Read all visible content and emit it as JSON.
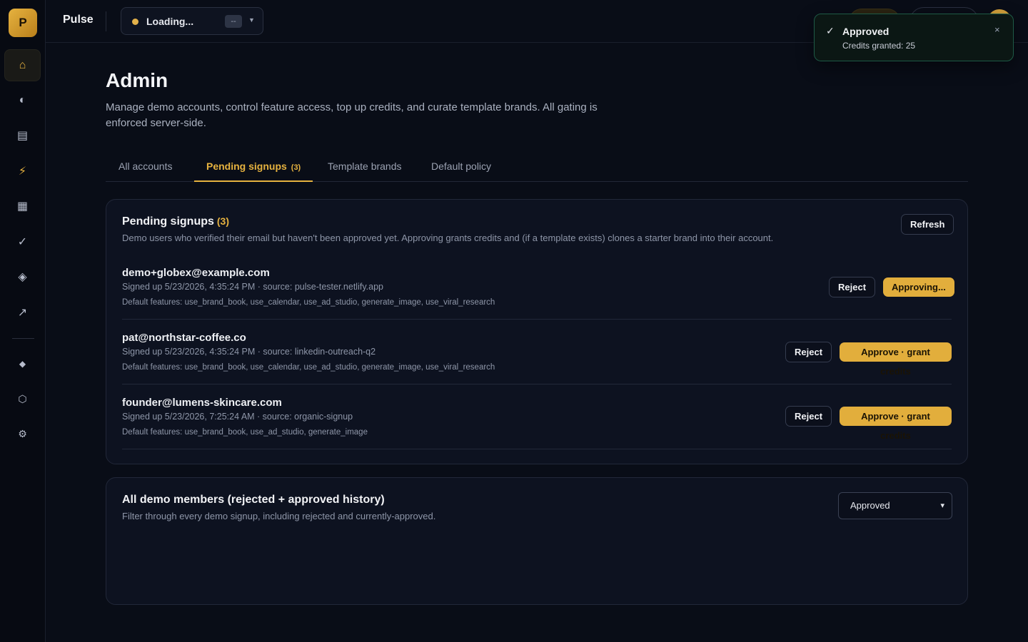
{
  "app": {
    "logo_letter": "P",
    "name": "Pulse"
  },
  "brand_selector": {
    "label": "Loading...",
    "chip": "--"
  },
  "sidebar": {
    "items": [
      {
        "icon": "home-icon",
        "glyph": "⌂",
        "active": true
      },
      {
        "icon": "contrast-icon",
        "glyph": "◐"
      },
      {
        "icon": "document-icon",
        "glyph": "▤"
      },
      {
        "icon": "lightning-icon",
        "glyph": "⚡"
      },
      {
        "icon": "calendar-icon",
        "glyph": "▦"
      },
      {
        "icon": "check-icon",
        "glyph": "✓"
      },
      {
        "icon": "diamond-icon",
        "glyph": "◈"
      },
      {
        "icon": "trend-icon",
        "glyph": "↗"
      },
      {
        "icon": "gem-icon",
        "glyph": "◆"
      },
      {
        "icon": "hexagon-icon",
        "glyph": "⬡"
      },
      {
        "icon": "gear-icon",
        "glyph": "⚙"
      }
    ]
  },
  "toast": {
    "title": "Approved",
    "body": "Credits granted: 25",
    "close": "×",
    "check": "✓"
  },
  "page": {
    "title": "Admin",
    "description": "Manage demo accounts, control feature access, top up credits, and curate template brands. All gating is enforced server-side."
  },
  "tabs": [
    {
      "label": "All accounts"
    },
    {
      "label": "Pending signups",
      "badge": "(3)",
      "active": true
    },
    {
      "label": "Template brands"
    },
    {
      "label": "Default policy"
    }
  ],
  "pending": {
    "title": "Pending signups",
    "count": "(3)",
    "subtitle": "Demo users who verified their email but haven't been approved yet. Approving grants credits and (if a template exists) clones a starter brand into their account.",
    "refresh_label": "Refresh",
    "reject_label": "Reject",
    "rows": [
      {
        "email": "demo+globex@example.com",
        "meta": "Signed up 5/23/2026, 4:35:24 PM · source: pulse-tester.netlify.app",
        "features": "Default features: use_brand_book, use_calendar, use_ad_studio, generate_image, use_viral_research",
        "approve_label": "Approving..."
      },
      {
        "email": "pat@northstar-coffee.co",
        "meta": "Signed up 5/23/2026, 4:35:24 PM · source: linkedin-outreach-q2",
        "features": "Default features: use_brand_book, use_calendar, use_ad_studio, generate_image, use_viral_research",
        "approve_label": "Approve · grant credits"
      },
      {
        "email": "founder@lumens-skincare.com",
        "meta": "Signed up 5/23/2026, 7:25:24 AM · source: organic-signup",
        "features": "Default features: use_brand_book, use_ad_studio, generate_image",
        "approve_label": "Approve · grant credits"
      }
    ]
  },
  "members": {
    "title": "All demo members (rejected + approved history)",
    "subtitle": "Filter through every demo signup, including rejected and currently-approved.",
    "filter_value": "Approved"
  }
}
